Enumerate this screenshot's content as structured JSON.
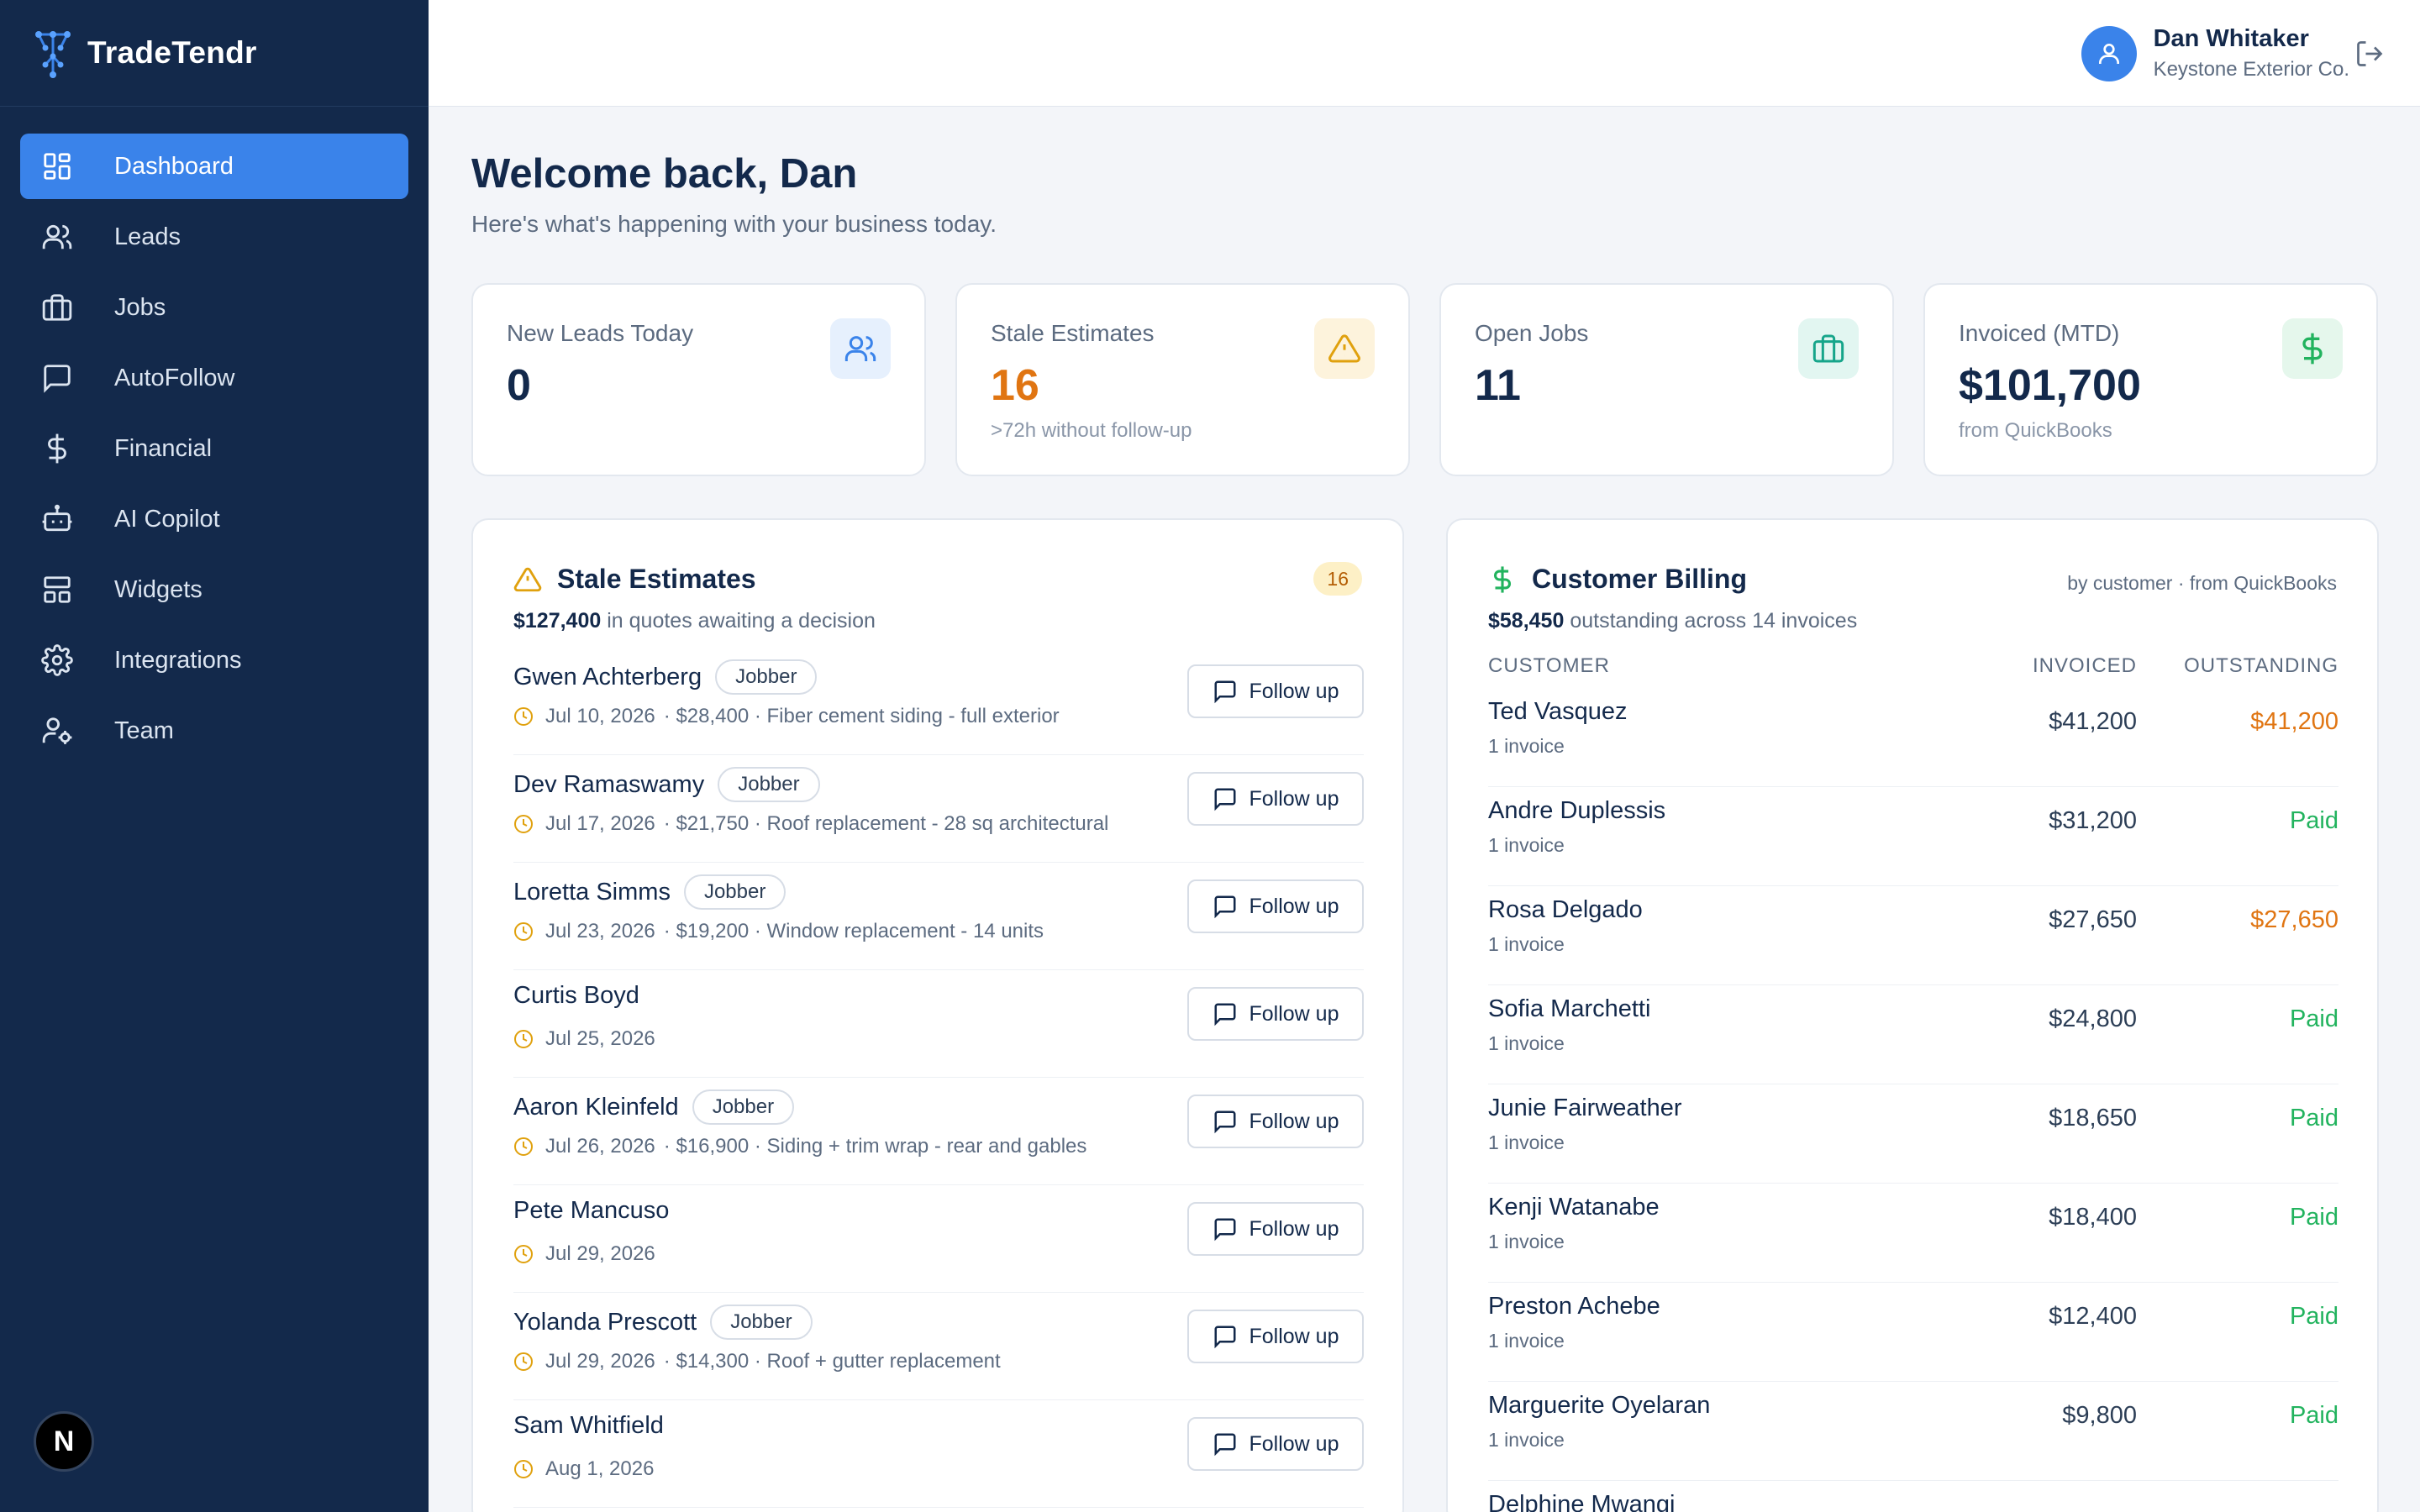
{
  "app": {
    "name": "TradeTendr"
  },
  "colors": {
    "sidebar": "#13294b",
    "accent": "#3a83ea",
    "warning": "#e07512",
    "success": "#22b35e"
  },
  "sidebar": {
    "items": [
      {
        "label": "Dashboard",
        "icon": "dashboard-icon",
        "active": true
      },
      {
        "label": "Leads",
        "icon": "users-icon"
      },
      {
        "label": "Jobs",
        "icon": "briefcase-icon"
      },
      {
        "label": "AutoFollow",
        "icon": "message-icon"
      },
      {
        "label": "Financial",
        "icon": "dollar-icon"
      },
      {
        "label": "AI Copilot",
        "icon": "bot-icon"
      },
      {
        "label": "Widgets",
        "icon": "layout-icon"
      },
      {
        "label": "Integrations",
        "icon": "gear-icon"
      },
      {
        "label": "Team",
        "icon": "user-cog-icon"
      }
    ],
    "bottom_badge": "N"
  },
  "header": {
    "user_name": "Dan Whitaker",
    "company": "Keystone Exterior Co."
  },
  "main": {
    "welcome": "Welcome back, Dan",
    "subtitle": "Here's what's happening with your business today."
  },
  "stats": [
    {
      "label": "New Leads Today",
      "value": "0",
      "note": "",
      "icon": "users-icon"
    },
    {
      "label": "Stale Estimates",
      "value": "16",
      "note": ">72h without follow-up",
      "icon": "warning-icon"
    },
    {
      "label": "Open Jobs",
      "value": "11",
      "note": "",
      "icon": "briefcase-icon"
    },
    {
      "label": "Invoiced (MTD)",
      "value": "$101,700",
      "note": "from QuickBooks",
      "icon": "dollar-icon"
    }
  ],
  "stale": {
    "title": "Stale Estimates",
    "count": "16",
    "amount": "$127,400",
    "amount_text": "in quotes awaiting a decision",
    "follow_label": "Follow up",
    "items": [
      {
        "name": "Gwen Achterberg",
        "tag": "Jobber",
        "date": "Jul 10, 2026",
        "detail": "· $28,400 · Fiber cement siding - full exterior"
      },
      {
        "name": "Dev Ramaswamy",
        "tag": "Jobber",
        "date": "Jul 17, 2026",
        "detail": "· $21,750 · Roof replacement - 28 sq architectural"
      },
      {
        "name": "Loretta Simms",
        "tag": "Jobber",
        "date": "Jul 23, 2026",
        "detail": "· $19,200 · Window replacement - 14 units"
      },
      {
        "name": "Curtis Boyd",
        "tag": "",
        "date": "Jul 25, 2026",
        "detail": ""
      },
      {
        "name": "Aaron Kleinfeld",
        "tag": "Jobber",
        "date": "Jul 26, 2026",
        "detail": "· $16,900 · Siding + trim wrap - rear and gables"
      },
      {
        "name": "Pete Mancuso",
        "tag": "",
        "date": "Jul 29, 2026",
        "detail": ""
      },
      {
        "name": "Yolanda Prescott",
        "tag": "Jobber",
        "date": "Jul 29, 2026",
        "detail": "· $14,300 · Roof + gutter replacement"
      },
      {
        "name": "Sam Whitfield",
        "tag": "",
        "date": "Aug 1, 2026",
        "detail": ""
      }
    ]
  },
  "billing": {
    "title": "Customer Billing",
    "note": "by customer · from QuickBooks",
    "amount": "$58,450",
    "amount_text": "outstanding across 14 invoices",
    "columns": {
      "customer": "CUSTOMER",
      "invoiced": "INVOICED",
      "outstanding": "OUTSTANDING"
    },
    "rows": [
      {
        "name": "Ted Vasquez",
        "count": "1 invoice",
        "invoiced": "$41,200",
        "outstanding": "$41,200",
        "status": "due"
      },
      {
        "name": "Andre Duplessis",
        "count": "1 invoice",
        "invoiced": "$31,200",
        "outstanding": "Paid",
        "status": "paid"
      },
      {
        "name": "Rosa Delgado",
        "count": "1 invoice",
        "invoiced": "$27,650",
        "outstanding": "$27,650",
        "status": "due"
      },
      {
        "name": "Sofia Marchetti",
        "count": "1 invoice",
        "invoiced": "$24,800",
        "outstanding": "Paid",
        "status": "paid"
      },
      {
        "name": "Junie Fairweather",
        "count": "1 invoice",
        "invoiced": "$18,650",
        "outstanding": "Paid",
        "status": "paid"
      },
      {
        "name": "Kenji Watanabe",
        "count": "1 invoice",
        "invoiced": "$18,400",
        "outstanding": "Paid",
        "status": "paid"
      },
      {
        "name": "Preston Achebe",
        "count": "1 invoice",
        "invoiced": "$12,400",
        "outstanding": "Paid",
        "status": "paid"
      },
      {
        "name": "Marguerite Oyelaran",
        "count": "1 invoice",
        "invoiced": "$9,800",
        "outstanding": "Paid",
        "status": "paid"
      },
      {
        "name": "Delphine Mwangi",
        "count": "",
        "invoiced": "",
        "outstanding": "",
        "status": ""
      }
    ]
  }
}
